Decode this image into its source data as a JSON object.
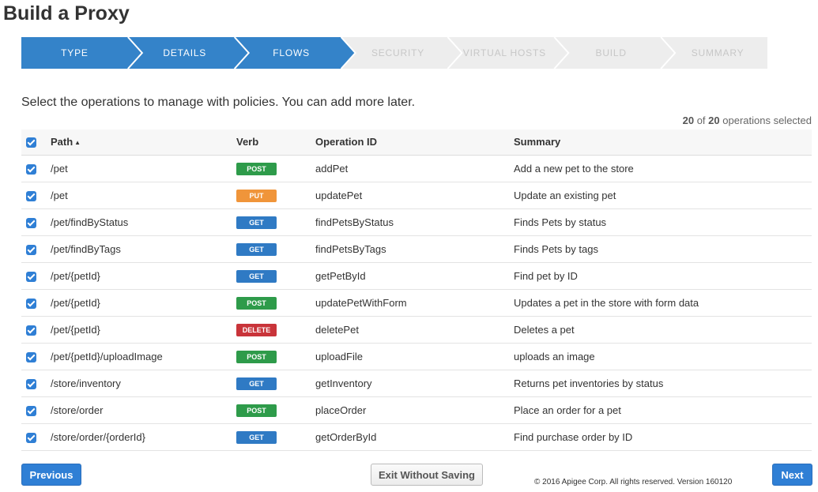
{
  "page": {
    "title": "Build a Proxy"
  },
  "wizard": {
    "colors": {
      "done": "#3483c9",
      "pending": "#ededed",
      "separator": "#ffffff"
    },
    "steps": [
      {
        "label": "TYPE",
        "state": "done"
      },
      {
        "label": "DETAILS",
        "state": "done"
      },
      {
        "label": "FLOWS",
        "state": "done"
      },
      {
        "label": "SECURITY",
        "state": "pending"
      },
      {
        "label": "VIRTUAL HOSTS",
        "state": "pending"
      },
      {
        "label": "BUILD",
        "state": "pending"
      },
      {
        "label": "SUMMARY",
        "state": "pending"
      }
    ]
  },
  "intro": "Select the operations to manage with policies. You can add more later.",
  "selection": {
    "selected": "20",
    "of_label": "of",
    "total": "20",
    "suffix": "operations selected"
  },
  "table": {
    "headers": {
      "path": "Path",
      "verb": "Verb",
      "operation_id": "Operation ID",
      "summary": "Summary"
    },
    "sort_icon": "▲",
    "verb_colors": {
      "POST": "#2e9b4a",
      "PUT": "#f0953a",
      "GET": "#2f7ac4",
      "DELETE": "#c9343a"
    },
    "rows": [
      {
        "checked": true,
        "path": "/pet",
        "verb": "POST",
        "operation_id": "addPet",
        "summary": "Add a new pet to the store"
      },
      {
        "checked": true,
        "path": "/pet",
        "verb": "PUT",
        "operation_id": "updatePet",
        "summary": "Update an existing pet"
      },
      {
        "checked": true,
        "path": "/pet/findByStatus",
        "verb": "GET",
        "operation_id": "findPetsByStatus",
        "summary": "Finds Pets by status"
      },
      {
        "checked": true,
        "path": "/pet/findByTags",
        "verb": "GET",
        "operation_id": "findPetsByTags",
        "summary": "Finds Pets by tags"
      },
      {
        "checked": true,
        "path": "/pet/{petId}",
        "verb": "GET",
        "operation_id": "getPetById",
        "summary": "Find pet by ID"
      },
      {
        "checked": true,
        "path": "/pet/{petId}",
        "verb": "POST",
        "operation_id": "updatePetWithForm",
        "summary": "Updates a pet in the store with form data"
      },
      {
        "checked": true,
        "path": "/pet/{petId}",
        "verb": "DELETE",
        "operation_id": "deletePet",
        "summary": "Deletes a pet"
      },
      {
        "checked": true,
        "path": "/pet/{petId}/uploadImage",
        "verb": "POST",
        "operation_id": "uploadFile",
        "summary": "uploads an image"
      },
      {
        "checked": true,
        "path": "/store/inventory",
        "verb": "GET",
        "operation_id": "getInventory",
        "summary": "Returns pet inventories by status"
      },
      {
        "checked": true,
        "path": "/store/order",
        "verb": "POST",
        "operation_id": "placeOrder",
        "summary": "Place an order for a pet"
      },
      {
        "checked": true,
        "path": "/store/order/{orderId}",
        "verb": "GET",
        "operation_id": "getOrderById",
        "summary": "Find purchase order by ID"
      }
    ]
  },
  "footer": {
    "previous_label": "Previous",
    "exit_label": "Exit Without Saving",
    "next_label": "Next",
    "copyright": "© 2016 Apigee Corp. All rights reserved. Version 160120"
  }
}
